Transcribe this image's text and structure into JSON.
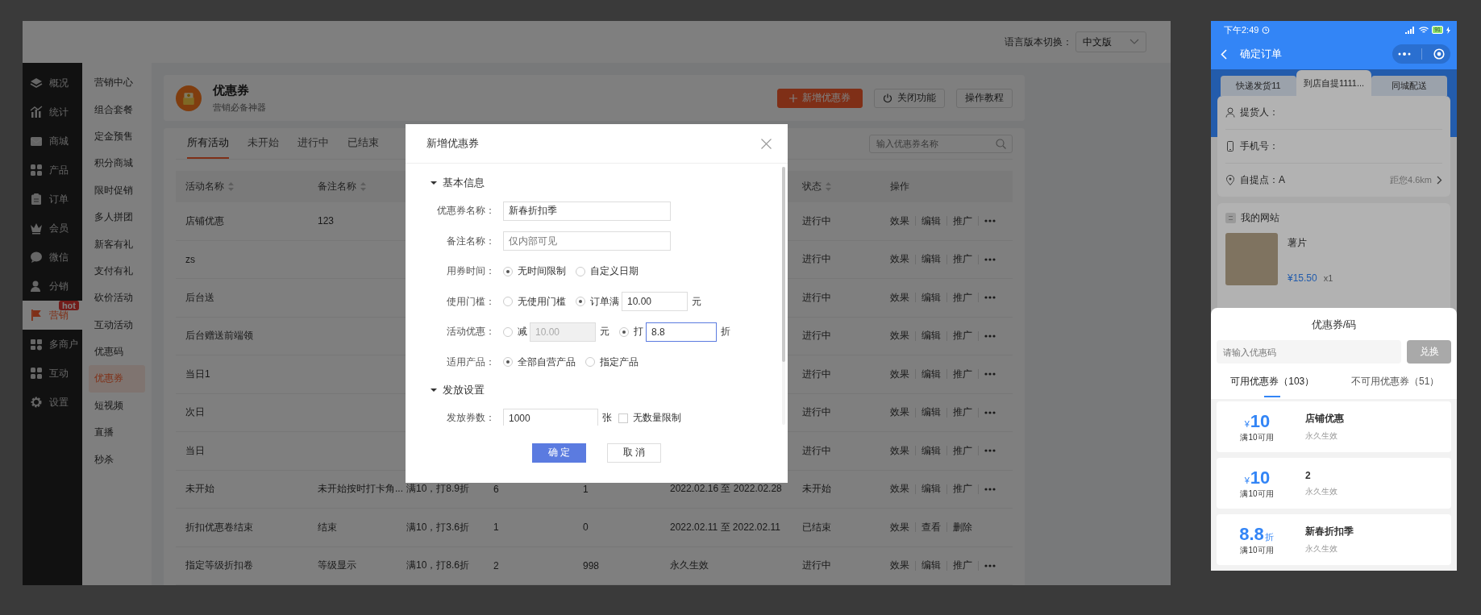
{
  "admin": {
    "language": {
      "label": "语言版本切换：",
      "value": "中文版"
    },
    "sidebar": [
      {
        "label": "概况",
        "selected": false
      },
      {
        "label": "统计",
        "selected": false
      },
      {
        "label": "商城",
        "selected": false
      },
      {
        "label": "产品",
        "selected": false
      },
      {
        "label": "订单",
        "selected": false
      },
      {
        "label": "会员",
        "selected": false
      },
      {
        "label": "微信",
        "selected": false
      },
      {
        "label": "分销",
        "selected": false
      },
      {
        "label": "营销",
        "selected": true,
        "badge": "hot"
      },
      {
        "label": "多商户",
        "selected": false
      },
      {
        "label": "互动",
        "selected": false
      },
      {
        "label": "设置",
        "selected": false
      }
    ],
    "submenu": [
      {
        "label": "营销中心",
        "selected": false
      },
      {
        "label": "组合套餐",
        "selected": false
      },
      {
        "label": "定金预售",
        "selected": false
      },
      {
        "label": "积分商城",
        "selected": false
      },
      {
        "label": "限时促销",
        "selected": false
      },
      {
        "label": "多人拼团",
        "selected": false
      },
      {
        "label": "新客有礼",
        "selected": false
      },
      {
        "label": "支付有礼",
        "selected": false
      },
      {
        "label": "砍价活动",
        "selected": false
      },
      {
        "label": "互动活动",
        "selected": false
      },
      {
        "label": "优惠码",
        "selected": false
      },
      {
        "label": "优惠券",
        "selected": true
      },
      {
        "label": "短视频",
        "selected": false
      },
      {
        "label": "直播",
        "selected": false
      },
      {
        "label": "秒杀",
        "selected": false
      }
    ],
    "header": {
      "title": "优惠券",
      "subtitle": "营销必备神器",
      "buttons": [
        {
          "label": "新增优惠券",
          "kind": "primary"
        },
        {
          "label": "关闭功能",
          "kind": "power"
        },
        {
          "label": "操作教程",
          "kind": "plain"
        }
      ]
    },
    "tabs": [
      {
        "label": "所有活动",
        "selected": true
      },
      {
        "label": "未开始",
        "selected": false
      },
      {
        "label": "进行中",
        "selected": false
      },
      {
        "label": "已结束",
        "selected": false
      }
    ],
    "search": {
      "placeholder": "输入优惠券名称"
    },
    "table": {
      "columns": {
        "name": {
          "label": "活动名称",
          "sortable": true
        },
        "remark": {
          "label": "备注名称",
          "sortable": true
        },
        "status": {
          "label": "状态",
          "sortable": true
        },
        "actions": {
          "label": "操作",
          "sortable": false
        }
      },
      "rows": [
        {
          "name": "店铺优惠",
          "remark": "123",
          "status": "进行中",
          "actions": [
            "效果",
            "编辑",
            "推广"
          ],
          "more": true
        },
        {
          "name": "zs",
          "status": "进行中",
          "actions": [
            "效果",
            "编辑",
            "推广"
          ],
          "more": true
        },
        {
          "name": "后台送",
          "status": "进行中",
          "actions": [
            "效果",
            "编辑",
            "推广"
          ],
          "more": true
        },
        {
          "name": "后台赠送前端领",
          "status": "进行中",
          "actions": [
            "效果",
            "编辑",
            "推广"
          ],
          "more": true
        },
        {
          "name": "当日1",
          "status": "进行中",
          "actions": [
            "效果",
            "编辑",
            "推广"
          ],
          "more": true
        },
        {
          "name": "次日",
          "status": "进行中",
          "actions": [
            "效果",
            "编辑",
            "推广"
          ],
          "more": true
        },
        {
          "name": "当日",
          "status": "进行中",
          "actions": [
            "效果",
            "编辑",
            "推广"
          ],
          "more": true
        },
        {
          "name": "未开始",
          "remark": "未开始按时打卡角...",
          "column_3": "满10，打8.9折",
          "column_4": "6",
          "column_5": "1",
          "column_6": "2022.02.16 至 2022.02.28",
          "status": "未开始",
          "actions": [
            "效果",
            "编辑",
            "推广"
          ],
          "more": true
        },
        {
          "name": "折扣优惠卷结束",
          "remark": "结束",
          "column_3": "满10，打3.6折",
          "column_4": "1",
          "column_5": "0",
          "column_6": "2022.02.11 至 2022.02.11",
          "status": "已结束",
          "actions": [
            "效果",
            "查看",
            "删除"
          ],
          "more": false
        },
        {
          "name": "指定等级折扣卷",
          "remark": "等级显示",
          "column_3": "满10，打8.6折",
          "column_4": "2",
          "column_5": "998",
          "column_6": "永久生效",
          "status": "进行中",
          "actions": [
            "效果",
            "编辑",
            "推广"
          ],
          "more": true
        }
      ]
    },
    "dialog": {
      "title": "新增优惠券",
      "sections": [
        {
          "title": "基本信息",
          "expanded": true,
          "fields": [
            {
              "kind": "input",
              "label": "优惠券名称：",
              "value": "新春折扣季"
            },
            {
              "kind": "input",
              "label": "备注名称：",
              "placeholder": "仅内部可见"
            },
            {
              "kind": "radio",
              "label": "用券时间：",
              "options": [
                {
                  "label": "无时间限制",
                  "selected": true
                },
                {
                  "label": "自定义日期",
                  "selected": false
                }
              ]
            },
            {
              "kind": "radio",
              "label": "使用门槛：",
              "options": [
                {
                  "label": "无使用门槛",
                  "selected": false
                },
                {
                  "label": "订单满",
                  "selected": true,
                  "input": {
                    "value": "10.00",
                    "disabled": false,
                    "focused": false
                  },
                  "unit": "元"
                }
              ]
            },
            {
              "kind": "radio",
              "label": "活动优惠：",
              "options": [
                {
                  "label": "减",
                  "selected": false,
                  "input": {
                    "value": "10.00",
                    "disabled": true,
                    "focused": false
                  },
                  "unit": "元"
                },
                {
                  "label": "打",
                  "selected": true,
                  "input": {
                    "value": "8.8",
                    "disabled": false,
                    "focused": true
                  },
                  "unit": "折"
                }
              ]
            },
            {
              "kind": "radio",
              "label": "适用产品：",
              "options": [
                {
                  "label": "全部自营产品",
                  "selected": true
                },
                {
                  "label": "指定产品",
                  "selected": false
                }
              ]
            }
          ]
        },
        {
          "title": "发放设置",
          "expanded": true,
          "fields": [
            {
              "kind": "count",
              "label": "发放券数：",
              "value": "1000",
              "unit": "张",
              "checkbox": {
                "label": "无数量限制",
                "checked": false
              }
            }
          ]
        }
      ],
      "buttons": [
        {
          "label": "确 定",
          "kind": "primary"
        },
        {
          "label": "取 消",
          "kind": "plain"
        }
      ]
    }
  },
  "phone": {
    "status_bar": {
      "time": "下午2:49",
      "battery": "91"
    },
    "nav": {
      "title": "确定订单"
    },
    "delivery_tabs": [
      {
        "label": "快递发货11",
        "selected": false
      },
      {
        "label": "到店自提1111...",
        "selected": true
      },
      {
        "label": "同城配送",
        "selected": false
      }
    ],
    "pickup": {
      "rows": [
        {
          "kind": "person",
          "label": "提货人："
        },
        {
          "kind": "phone",
          "label": "手机号："
        },
        {
          "kind": "location",
          "label": "自提点：A",
          "distance": "距您4.6km"
        }
      ]
    },
    "store": {
      "name": "我的网站",
      "product": {
        "name": "薯片",
        "price": "¥15.50",
        "quantity": "x1"
      }
    },
    "coupon_sheet": {
      "title": "优惠券/码",
      "code_placeholder": "请输入优惠码",
      "redeem": "兑换",
      "tabs": [
        {
          "label": "可用优惠券（103）",
          "selected": true
        },
        {
          "label": "不可用优惠券（51）",
          "selected": false
        }
      ],
      "coupons": [
        {
          "kind": "cash",
          "symbol": "¥",
          "amount": "10",
          "condition": "满10可用",
          "name": "店铺优惠",
          "validity": "永久生效"
        },
        {
          "kind": "cash",
          "symbol": "¥",
          "amount": "10",
          "condition": "满10可用",
          "name": "2",
          "validity": "永久生效"
        },
        {
          "kind": "discount",
          "symbol": "折",
          "amount": "8.8",
          "condition": "满10可用",
          "name": "新春折扣季",
          "validity": "永久生效"
        }
      ]
    }
  }
}
